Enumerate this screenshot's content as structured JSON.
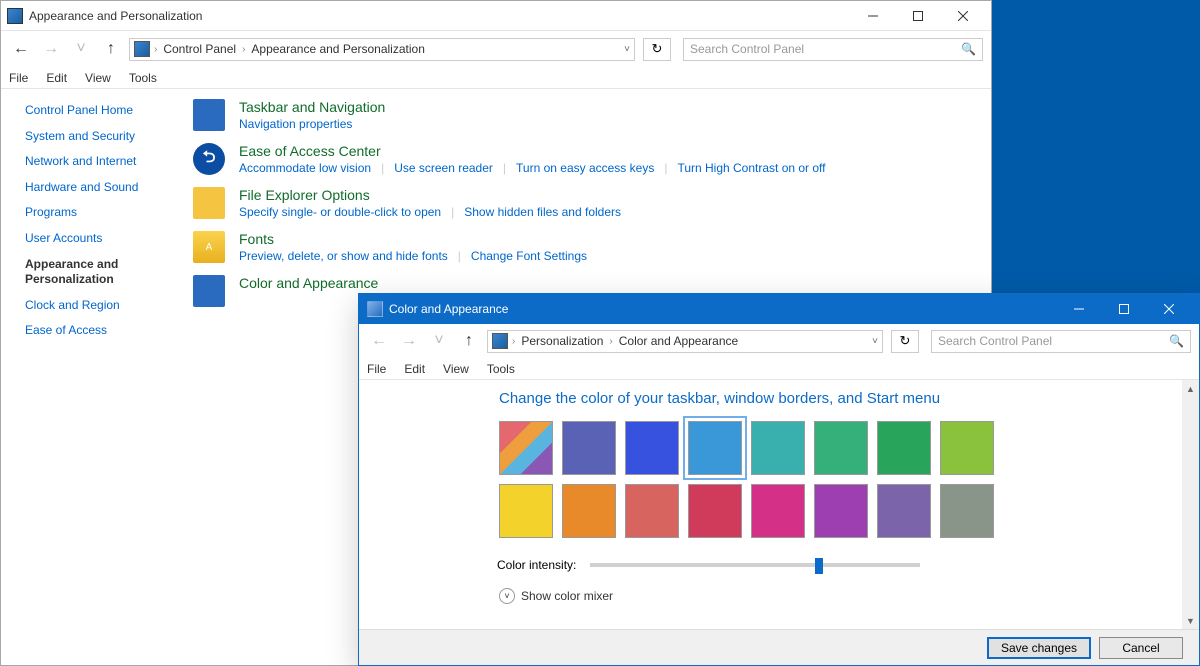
{
  "main_window": {
    "title": "Appearance and Personalization",
    "breadcrumb": [
      "Control Panel",
      "Appearance and Personalization"
    ],
    "search_placeholder": "Search Control Panel",
    "menus": [
      "File",
      "Edit",
      "View",
      "Tools"
    ],
    "left_links": [
      {
        "label": "Control Panel Home",
        "bold": false
      },
      {
        "label": "System and Security",
        "bold": false
      },
      {
        "label": "Network and Internet",
        "bold": false
      },
      {
        "label": "Hardware and Sound",
        "bold": false
      },
      {
        "label": "Programs",
        "bold": false
      },
      {
        "label": "User Accounts",
        "bold": false
      },
      {
        "label": "Appearance and Personalization",
        "bold": true
      },
      {
        "label": "Clock and Region",
        "bold": false
      },
      {
        "label": "Ease of Access",
        "bold": false
      }
    ],
    "categories": [
      {
        "title": "Taskbar and Navigation",
        "links": [
          "Navigation properties"
        ]
      },
      {
        "title": "Ease of Access Center",
        "links": [
          "Accommodate low vision",
          "Use screen reader",
          "Turn on easy access keys",
          "Turn High Contrast on or off"
        ]
      },
      {
        "title": "File Explorer Options",
        "links": [
          "Specify single- or double-click to open",
          "Show hidden files and folders"
        ]
      },
      {
        "title": "Fonts",
        "links": [
          "Preview, delete, or show and hide fonts",
          "Change Font Settings"
        ]
      },
      {
        "title": "Color and Appearance",
        "links": []
      }
    ]
  },
  "overlay_window": {
    "title": "Color and Appearance",
    "breadcrumb": [
      "Personalization",
      "Color and Appearance"
    ],
    "search_placeholder": "Search Control Panel",
    "menus": [
      "File",
      "Edit",
      "View",
      "Tools"
    ],
    "heading": "Change the color of your taskbar, window borders, and Start menu",
    "colors_row1": [
      "auto",
      "#5a62b5",
      "#3852e0",
      "#3a98d9",
      "#39b0ae",
      "#36b07a",
      "#29a55b",
      "#8ac23d"
    ],
    "colors_row2": [
      "#f3d22b",
      "#e98a2a",
      "#d8645f",
      "#d03a5b",
      "#d53087",
      "#9d3fb1",
      "#7b64aa",
      "#8a958a"
    ],
    "selected_index": 3,
    "intensity_label": "Color intensity:",
    "intensity_value": 0.68,
    "mixer_label": "Show color mixer",
    "save_label": "Save changes",
    "cancel_label": "Cancel"
  }
}
